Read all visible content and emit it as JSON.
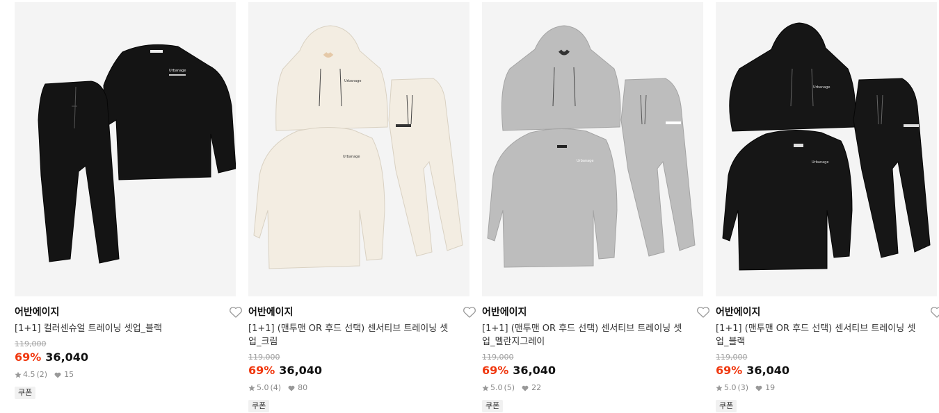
{
  "products": [
    {
      "brand": "어반에이지",
      "name": "[1+1] 컬러센슈얼 트레이닝 셋업_블랙",
      "original_price": "119,000",
      "discount": "69%",
      "price": "36,040",
      "rating": "4.5",
      "review_count": "(2)",
      "likes": "15",
      "coupon": "쿠폰",
      "product_color": "#141414"
    },
    {
      "brand": "어반에이지",
      "name": "[1+1] (맨투맨 OR 후드 선택) 센서티브 트레이닝 셋업_크림",
      "original_price": "119,000",
      "discount": "69%",
      "price": "36,040",
      "rating": "5.0",
      "review_count": "(4)",
      "likes": "80",
      "coupon": "쿠폰",
      "product_color": "#f3ede2"
    },
    {
      "brand": "어반에이지",
      "name": "[1+1] (맨투맨 OR 후드 선택) 센서티브 트레이닝 셋업_멜란지그레이",
      "original_price": "119,000",
      "discount": "69%",
      "price": "36,040",
      "rating": "5.0",
      "review_count": "(5)",
      "likes": "22",
      "coupon": "쿠폰",
      "product_color": "#bdbdbd"
    },
    {
      "brand": "어반에이지",
      "name": "[1+1] (맨투맨 OR 후드 선택) 센서티브 트레이닝 셋업_블랙",
      "original_price": "119,000",
      "discount": "69%",
      "price": "36,040",
      "rating": "5.0",
      "review_count": "(3)",
      "likes": "19",
      "coupon": "쿠폰",
      "product_color": "#161616"
    }
  ],
  "icons": {
    "like": "heart-outline-icon",
    "rating": "star-icon",
    "likes": "heart-filled-icon"
  },
  "colors": {
    "discount": "#f0380f",
    "image_background": "#f4f4f4"
  }
}
